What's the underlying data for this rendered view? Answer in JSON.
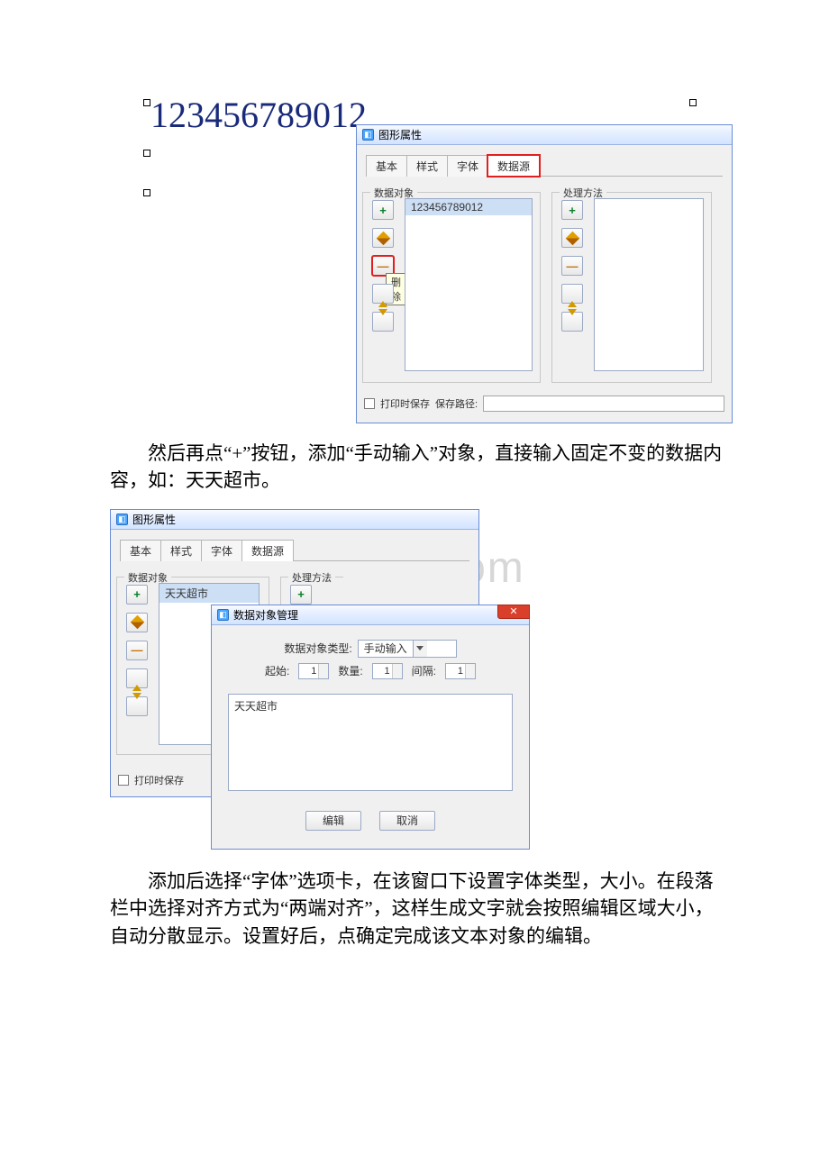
{
  "editor": {
    "big_number": "123456789012"
  },
  "win1": {
    "title": "图形属性",
    "tabs": {
      "basic": "基本",
      "style": "样式",
      "font": "字体",
      "datasource": "数据源"
    },
    "group_data_object": "数据对象",
    "group_process_method": "处理方法",
    "list_value": "123456789012",
    "tooltip_delete": "删除",
    "save_on_print_label": "打印时保存",
    "save_path_label": "保存路径:"
  },
  "para1": "然后再点“+”按钮，添加“手动输入”对象，直接输入固定不变的数据内容，如：天天超市。",
  "win2": {
    "title": "图形属性",
    "tabs": {
      "basic": "基本",
      "style": "样式",
      "font": "字体",
      "datasource": "数据源"
    },
    "group_data_object": "数据对象",
    "group_process_method": "处理方法",
    "list_value": "天天超市",
    "save_on_print_label": "打印时保存"
  },
  "win3": {
    "title": "数据对象管理",
    "type_label": "数据对象类型:",
    "type_value": "手动输入",
    "start_label": "起始:",
    "start_value": "1",
    "qty_label": "数量:",
    "qty_value": "1",
    "gap_label": "间隔:",
    "gap_value": "1",
    "textarea_value": "天天超市",
    "ok_label": "编辑",
    "cancel_label": "取消"
  },
  "para2": "添加后选择“字体”选项卡，在该窗口下设置字体类型，大小。在段落栏中选择对齐方式为“两端对齐”，这样生成文字就会按照编辑区域大小，自动分散显示。设置好后，点确定完成该文本对象的编辑。",
  "watermark": "www.bdocx.com"
}
